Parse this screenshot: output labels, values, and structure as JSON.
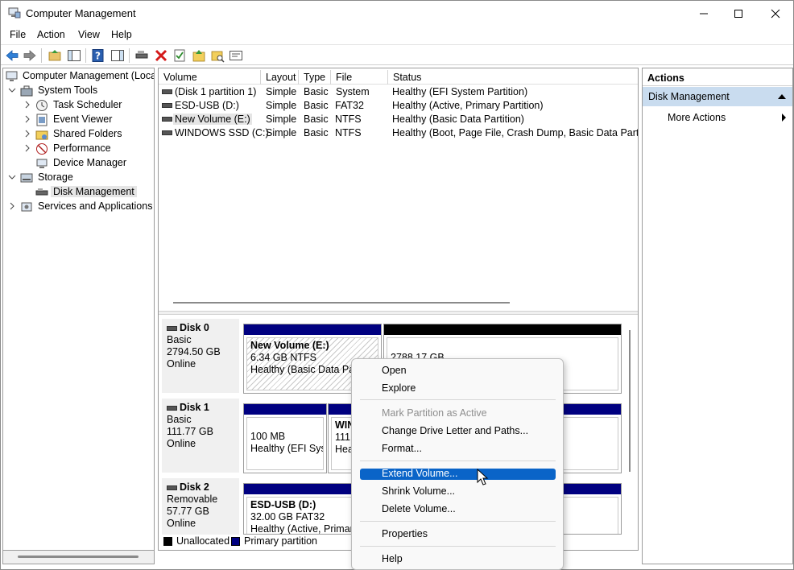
{
  "window": {
    "title": "Computer Management"
  },
  "menubar": [
    "File",
    "Action",
    "View",
    "Help"
  ],
  "tree": [
    {
      "label": "Computer Management (Local",
      "level": 0,
      "icon": "computer-icon",
      "expander": ""
    },
    {
      "label": "System Tools",
      "level": 1,
      "icon": "toolbox-icon",
      "expander": "down"
    },
    {
      "label": "Task Scheduler",
      "level": 2,
      "icon": "clock-icon",
      "expander": "right"
    },
    {
      "label": "Event Viewer",
      "level": 2,
      "icon": "event-log-icon",
      "expander": "right"
    },
    {
      "label": "Shared Folders",
      "level": 2,
      "icon": "shared-folder-icon",
      "expander": "right"
    },
    {
      "label": "Performance",
      "level": 2,
      "icon": "performance-icon",
      "expander": "right"
    },
    {
      "label": "Device Manager",
      "level": 2,
      "icon": "device-manager-icon",
      "expander": ""
    },
    {
      "label": "Storage",
      "level": 1,
      "icon": "storage-icon",
      "expander": "down"
    },
    {
      "label": "Disk Management",
      "level": 2,
      "icon": "disk-icon",
      "expander": "",
      "selected": true
    },
    {
      "label": "Services and Applications",
      "level": 1,
      "icon": "services-icon",
      "expander": "right"
    }
  ],
  "volumes": {
    "columns": [
      "Volume",
      "Layout",
      "Type",
      "File System",
      "Status"
    ],
    "rows": [
      [
        "(Disk 1 partition 1)",
        "Simple",
        "Basic",
        "",
        "Healthy (EFI System Partition)"
      ],
      [
        "ESD-USB (D:)",
        "Simple",
        "Basic",
        "FAT32",
        "Healthy (Active, Primary Partition)"
      ],
      [
        "New Volume (E:)",
        "Simple",
        "Basic",
        "NTFS",
        "Healthy (Basic Data Partition)"
      ],
      [
        "WINDOWS SSD (C:)",
        "Simple",
        "Basic",
        "NTFS",
        "Healthy (Boot, Page File, Crash Dump, Basic Data Partition"
      ]
    ],
    "selected_row": 2
  },
  "disks": [
    {
      "name": "Disk 0",
      "type": "Basic",
      "size": "2794.50 GB",
      "state": "Online",
      "partitions": [
        {
          "title": "New Volume  (E:)",
          "line2": "6.34 GB NTFS",
          "line3": "Healthy (Basic Data Partition)",
          "bar": "#000080",
          "hatched": true
        },
        {
          "title": "",
          "line2": "2788.17 GB",
          "line3": "",
          "bar": "#000000",
          "hatched": false
        }
      ]
    },
    {
      "name": "Disk 1",
      "type": "Basic",
      "size": "111.77 GB",
      "state": "Online",
      "partitions": [
        {
          "title": "",
          "line2": "100 MB",
          "line3": "Healthy (EFI Syst",
          "bar": "#000080",
          "hatched": false
        },
        {
          "title": "WIN",
          "line2": "111.6",
          "line3": "Heal",
          "bar": "#000080",
          "hatched": false
        }
      ]
    },
    {
      "name": "Disk 2",
      "type": "Removable",
      "size": "57.77 GB",
      "state": "Online",
      "partitions": [
        {
          "title": "ESD-USB  (D:)",
          "line2": "32.00 GB FAT32",
          "line3": "Healthy (Active, Primary",
          "bar": "#000080",
          "hatched": false
        }
      ]
    }
  ],
  "legend": [
    {
      "label": "Unallocated",
      "color": "#000000"
    },
    {
      "label": "Primary partition",
      "color": "#000080"
    }
  ],
  "actions": {
    "header": "Actions",
    "section": "Disk Management",
    "more": "More Actions"
  },
  "context_menu": {
    "items": [
      {
        "label": "Open",
        "disabled": false
      },
      {
        "label": "Explore",
        "disabled": false
      },
      {
        "sep": true
      },
      {
        "label": "Mark Partition as Active",
        "disabled": true
      },
      {
        "label": "Change Drive Letter and Paths...",
        "disabled": false
      },
      {
        "label": "Format...",
        "disabled": false
      },
      {
        "sep": true
      },
      {
        "label": "Extend Volume...",
        "disabled": false,
        "highlighted": true
      },
      {
        "label": "Shrink Volume...",
        "disabled": false
      },
      {
        "label": "Delete Volume...",
        "disabled": false
      },
      {
        "sep": true
      },
      {
        "label": "Properties",
        "disabled": false
      },
      {
        "sep": true
      },
      {
        "label": "Help",
        "disabled": false
      }
    ]
  }
}
